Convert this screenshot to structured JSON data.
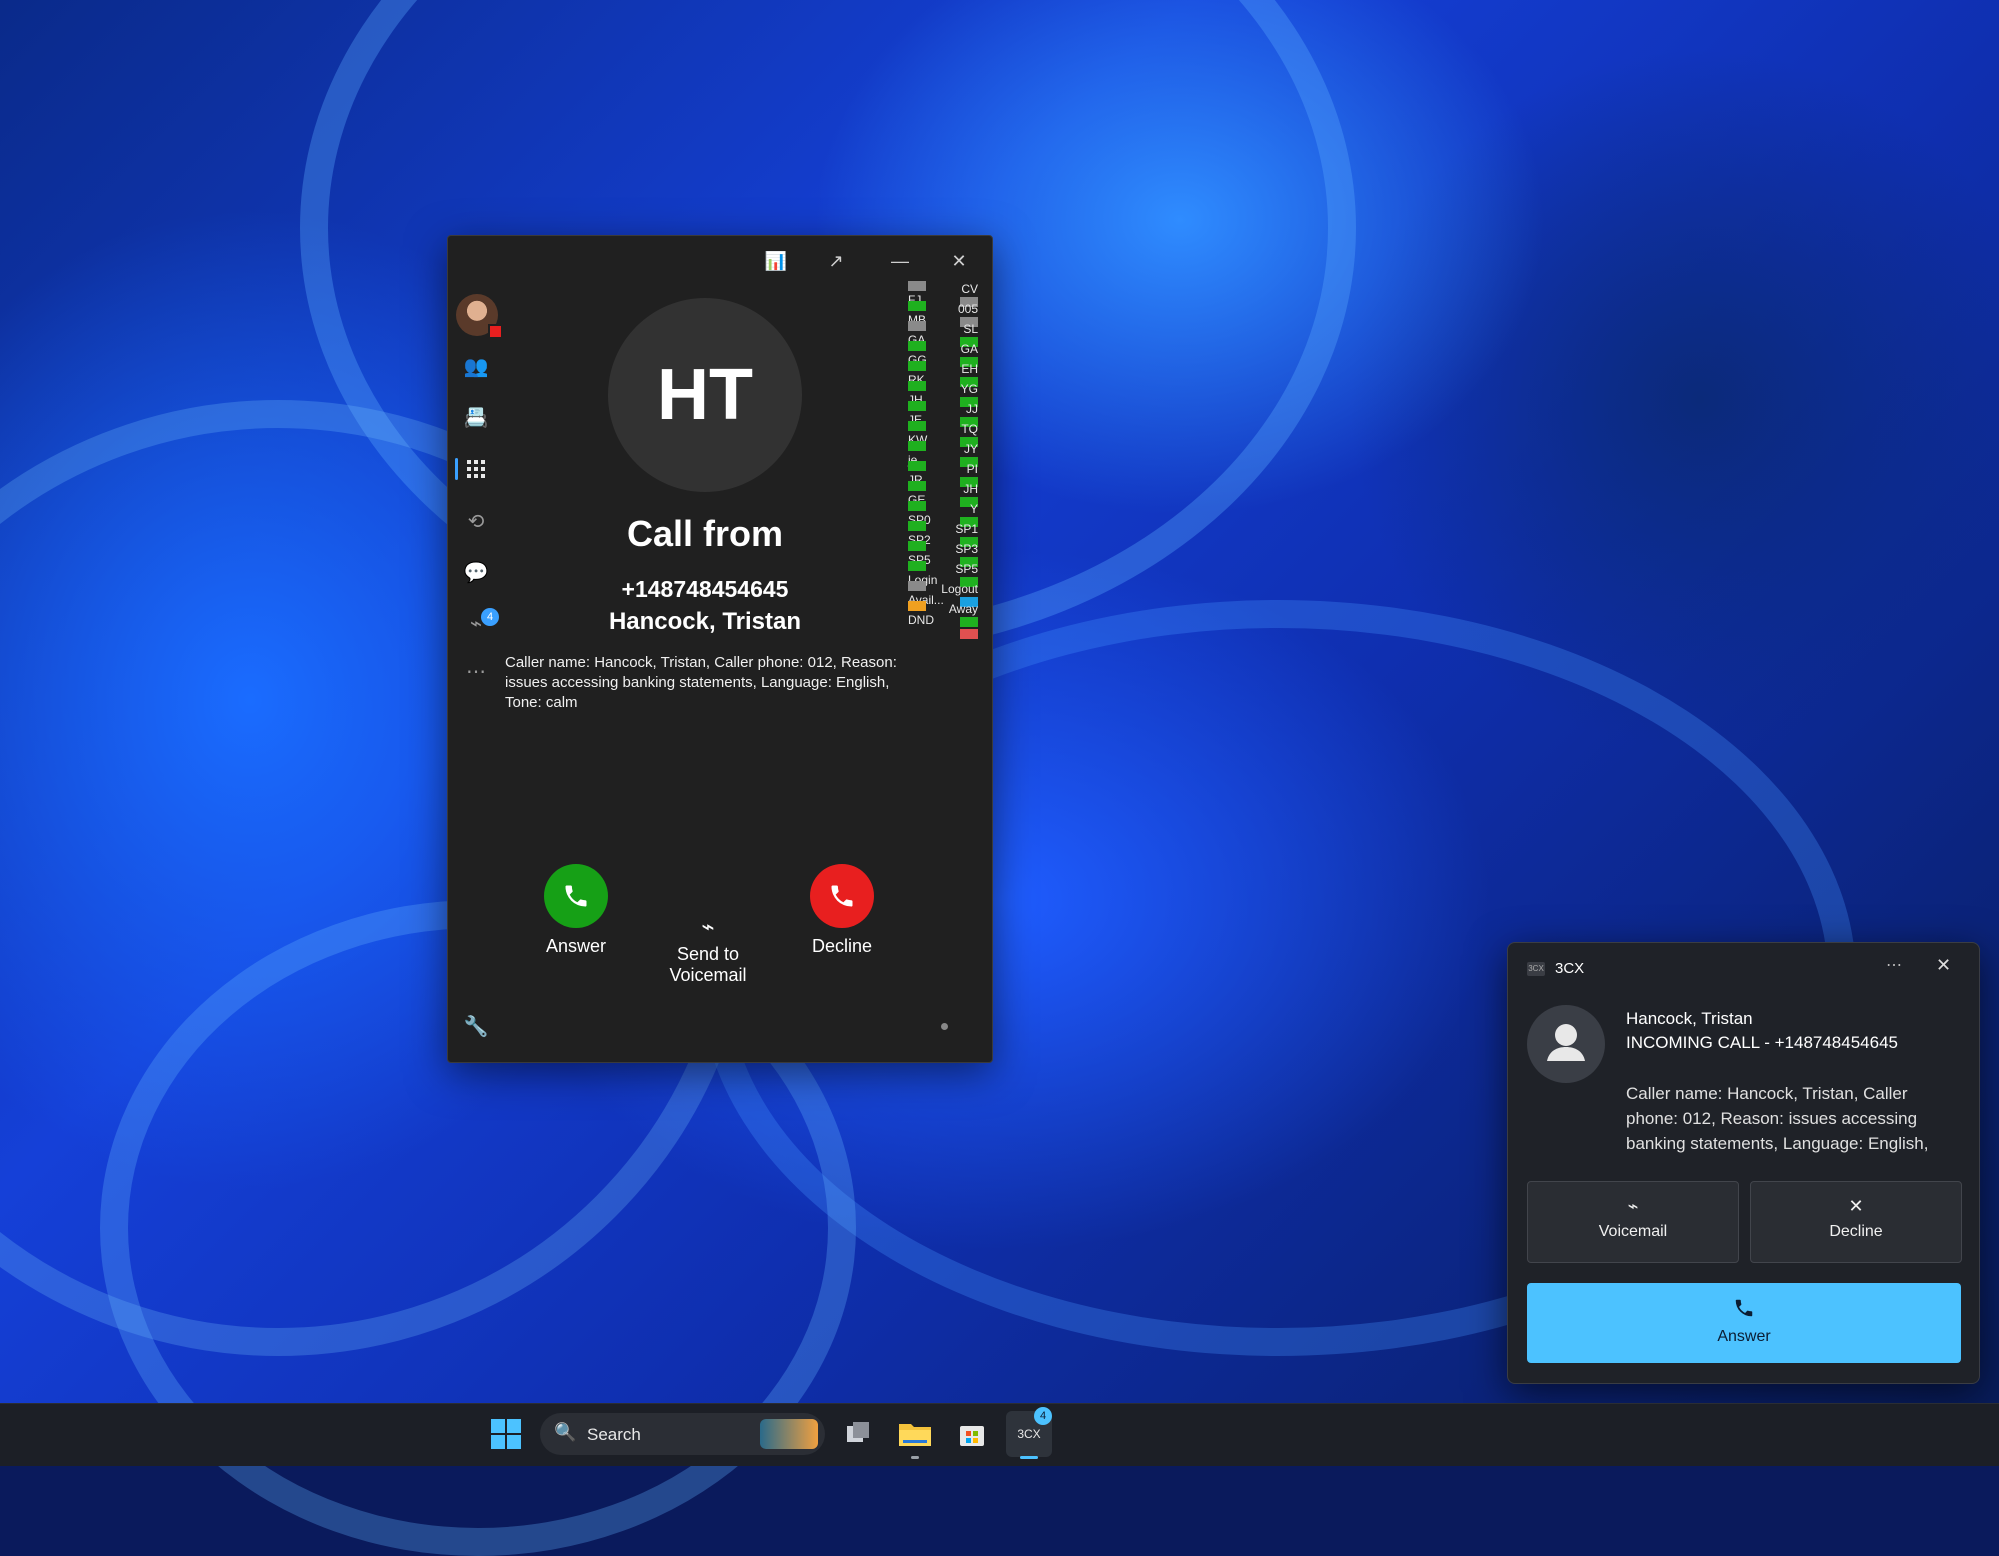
{
  "colors": {
    "answer_green": "#16a016",
    "decline_red": "#e81f1f",
    "accent_blue": "#4cc2ff",
    "window_bg": "#202020"
  },
  "phone": {
    "initials": "HT",
    "call_from": "Call from",
    "number": "+148748454645",
    "name": "Hancock, Tristan",
    "description": "Caller name: Hancock, Tristan, Caller phone: 012, Reason: issues accessing banking statements, Language: English, Tone: calm",
    "answer_label": "Answer",
    "voicemail_label_1": "Send to",
    "voicemail_label_2": "Voicemail",
    "decline_label": "Decline",
    "voicemail_badge": "4",
    "sidebar_icons": [
      "avatar",
      "people-icon",
      "contacts-icon",
      "dialpad-icon",
      "history-icon",
      "chat-icon",
      "voicemail-icon",
      "more-icon"
    ],
    "presence_left": [
      {
        "label": "FJ",
        "color": "#8a8a8a"
      },
      {
        "label": "MB",
        "color": "#1fb01f"
      },
      {
        "label": "GA",
        "color": "#8a8a8a"
      },
      {
        "label": "GG",
        "color": "#1fb01f"
      },
      {
        "label": "RK",
        "color": "#1fb01f"
      },
      {
        "label": "JH",
        "color": "#1fb01f"
      },
      {
        "label": "JE",
        "color": "#1fb01f"
      },
      {
        "label": "KW",
        "color": "#1fb01f"
      },
      {
        "label": "je",
        "color": "#1fb01f"
      },
      {
        "label": "JR",
        "color": "#1fb01f"
      },
      {
        "label": "GE",
        "color": "#1fb01f"
      },
      {
        "label": "SP0",
        "color": "#1fb01f"
      },
      {
        "label": "SP2",
        "color": "#1fb01f"
      },
      {
        "label": "SP5",
        "color": "#1fb01f"
      },
      {
        "label": "Login",
        "color": "#1fb01f"
      },
      {
        "label": "Avail...",
        "color": "#8a8a8a"
      },
      {
        "label": "DND",
        "color": "#f0a020"
      }
    ],
    "presence_right": [
      {
        "label": "CV",
        "color": "#8a8a8a"
      },
      {
        "label": "005",
        "color": "#8a8a8a"
      },
      {
        "label": "SL",
        "color": "#1fb01f"
      },
      {
        "label": "GA",
        "color": "#1fb01f"
      },
      {
        "label": "EH",
        "color": "#1fb01f"
      },
      {
        "label": "YG",
        "color": "#1fb01f"
      },
      {
        "label": "JJ",
        "color": "#1fb01f"
      },
      {
        "label": "TQ",
        "color": "#1fb01f"
      },
      {
        "label": "JY",
        "color": "#1fb01f"
      },
      {
        "label": "PI",
        "color": "#1fb01f"
      },
      {
        "label": "JH",
        "color": "#1fb01f"
      },
      {
        "label": "Y",
        "color": "#1fb01f"
      },
      {
        "label": "SP1",
        "color": "#1fb01f"
      },
      {
        "label": "SP3",
        "color": "#1fb01f"
      },
      {
        "label": "SP5",
        "color": "#1fb01f"
      },
      {
        "label": "Logout",
        "color": "#1aa0e0"
      },
      {
        "label": "Away",
        "color": "#1fb01f"
      }
    ],
    "presence_dnd_right": "#e05050"
  },
  "toast": {
    "app": "3CX",
    "app_icon": "3CX",
    "caller": "Hancock, Tristan",
    "incoming": "INCOMING CALL - +148748454645",
    "body": "Caller name: Hancock, Tristan, Caller phone: 012, Reason: issues accessing banking statements, Language: English,",
    "voicemail_label": "Voicemail",
    "decline_label": "Decline",
    "answer_label": "Answer"
  },
  "taskbar": {
    "search_placeholder": "Search",
    "badge": "4",
    "app_3cx": "3CX"
  }
}
